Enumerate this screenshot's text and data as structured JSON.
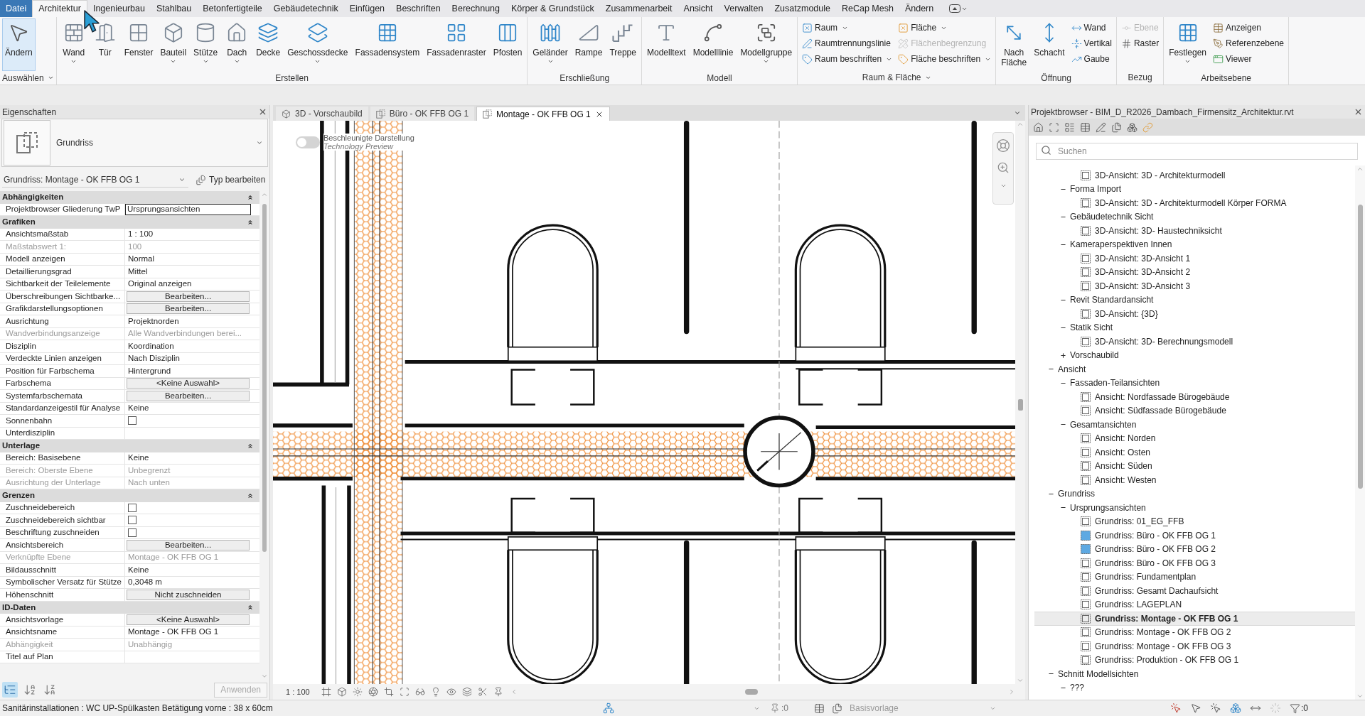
{
  "ribbon": {
    "tabs": [
      {
        "label": "Datei",
        "kind": "application",
        "selected": false
      },
      {
        "label": "Architektur",
        "kind": "tab",
        "selected": true
      },
      {
        "label": "Ingenieurbau",
        "kind": "tab",
        "selected": false
      },
      {
        "label": "Stahlbau",
        "kind": "tab",
        "selected": false
      },
      {
        "label": "Betonfertigteile",
        "kind": "tab",
        "selected": false
      },
      {
        "label": "Gebäudetechnik",
        "kind": "tab",
        "selected": false
      },
      {
        "label": "Einfügen",
        "kind": "tab",
        "selected": false
      },
      {
        "label": "Beschriften",
        "kind": "tab",
        "selected": false
      },
      {
        "label": "Berechnung",
        "kind": "tab",
        "selected": false
      },
      {
        "label": "Körper & Grundstück",
        "kind": "tab",
        "selected": false
      },
      {
        "label": "Zusammenarbeit",
        "kind": "tab",
        "selected": false
      },
      {
        "label": "Ansicht",
        "kind": "tab",
        "selected": false
      },
      {
        "label": "Verwalten",
        "kind": "tab",
        "selected": false
      },
      {
        "label": "Zusatzmodule",
        "kind": "tab",
        "selected": false
      },
      {
        "label": "ReCap Mesh",
        "kind": "tab",
        "selected": false
      },
      {
        "label": "Ändern",
        "kind": "tab",
        "selected": false
      }
    ],
    "panels": [
      {
        "title": "Auswählen",
        "menu": true,
        "tools": [
          {
            "label": "Ändern",
            "kind": "large",
            "menu": false,
            "active": true,
            "disabled": false
          }
        ]
      },
      {
        "title": "Erstellen",
        "menu": false,
        "tools": [
          {
            "label": "Wand",
            "kind": "large",
            "menu": true,
            "active": false,
            "disabled": false
          },
          {
            "label": "Tür",
            "kind": "large",
            "menu": false,
            "active": false,
            "disabled": false
          },
          {
            "label": "Fenster",
            "kind": "large",
            "menu": false,
            "active": false,
            "disabled": false
          },
          {
            "label": "Bauteil",
            "kind": "large",
            "menu": true,
            "active": false,
            "disabled": false
          },
          {
            "label": "Stütze",
            "kind": "large",
            "menu": true,
            "active": false,
            "disabled": false
          },
          {
            "label": "Dach",
            "kind": "large",
            "menu": true,
            "active": false,
            "disabled": false
          },
          {
            "label": "Decke",
            "kind": "large",
            "menu": false,
            "active": false,
            "disabled": false
          },
          {
            "label": "Geschossdecke",
            "kind": "large",
            "menu": true,
            "active": false,
            "disabled": false
          },
          {
            "label": "Fassadensystem",
            "kind": "large",
            "menu": false,
            "active": false,
            "disabled": false
          },
          {
            "label": "Fassadenraster",
            "kind": "large",
            "menu": false,
            "active": false,
            "disabled": false
          },
          {
            "label": "Pfosten",
            "kind": "large",
            "menu": false,
            "active": false,
            "disabled": false
          }
        ]
      },
      {
        "title": "Erschließung",
        "menu": false,
        "tools": [
          {
            "label": "Geländer",
            "kind": "large",
            "menu": true,
            "active": false,
            "disabled": false
          },
          {
            "label": "Rampe",
            "kind": "large",
            "menu": false,
            "active": false,
            "disabled": false
          },
          {
            "label": "Treppe",
            "kind": "large",
            "menu": false,
            "active": false,
            "disabled": false
          }
        ]
      },
      {
        "title": "Modell",
        "menu": false,
        "tools": [
          {
            "label": "Modelltext",
            "kind": "large",
            "menu": false,
            "active": false,
            "disabled": false
          },
          {
            "label": "Modelllinie",
            "kind": "large",
            "menu": false,
            "active": false,
            "disabled": false
          },
          {
            "label": "Modellgruppe",
            "kind": "large",
            "menu": true,
            "active": false,
            "disabled": false
          }
        ]
      },
      {
        "title": "Raum & Fläche",
        "menu": true,
        "tools": [
          {
            "label": "Raum",
            "kind": "small",
            "menu": true,
            "active": false,
            "disabled": false
          },
          {
            "label": "Raumtrennungslinie",
            "kind": "small",
            "menu": false,
            "active": false,
            "disabled": false
          },
          {
            "label": "Raum beschriften",
            "kind": "small",
            "menu": true,
            "active": false,
            "disabled": false
          },
          {
            "label": "Fläche",
            "kind": "small",
            "menu": true,
            "active": false,
            "disabled": false
          },
          {
            "label": "Flächenbegrenzung",
            "kind": "small",
            "menu": false,
            "active": false,
            "disabled": true
          },
          {
            "label": "Fläche beschriften",
            "kind": "small",
            "menu": true,
            "active": false,
            "disabled": false
          }
        ]
      },
      {
        "title": "Öffnung",
        "menu": false,
        "tools": [
          {
            "label": "Nach Fläche",
            "kind": "large",
            "menu": false,
            "active": false,
            "disabled": false
          },
          {
            "label": "Schacht",
            "kind": "large",
            "menu": false,
            "active": false,
            "disabled": false
          },
          {
            "label": "Wand",
            "kind": "small",
            "menu": false,
            "active": false,
            "disabled": false
          },
          {
            "label": "Vertikal",
            "kind": "small",
            "menu": false,
            "active": false,
            "disabled": false
          },
          {
            "label": "Gaube",
            "kind": "small",
            "menu": false,
            "active": false,
            "disabled": false
          }
        ]
      },
      {
        "title": "Bezug",
        "menu": false,
        "tools": [
          {
            "label": "Ebene",
            "kind": "small",
            "menu": false,
            "active": false,
            "disabled": true
          },
          {
            "label": "Raster",
            "kind": "small",
            "menu": false,
            "active": false,
            "disabled": false
          }
        ]
      },
      {
        "title": "Arbeitsebene",
        "menu": false,
        "tools": [
          {
            "label": "Festlegen",
            "kind": "large",
            "menu": true,
            "active": false,
            "disabled": false
          },
          {
            "label": "Anzeigen",
            "kind": "small",
            "menu": false,
            "active": false,
            "disabled": false
          },
          {
            "label": "Referenzebene",
            "kind": "small",
            "menu": false,
            "active": false,
            "disabled": false
          },
          {
            "label": "Viewer",
            "kind": "small",
            "menu": false,
            "active": false,
            "disabled": false
          }
        ]
      }
    ]
  },
  "properties": {
    "title": "Eigenschaften",
    "type_name": "Grundriss",
    "instance": "Grundriss: Montage - OK FFB OG 1",
    "edit_type": "Typ bearbeiten",
    "groups": [
      {
        "title": "Abhängigkeiten",
        "expanded": true,
        "rows": [
          {
            "label": "Projektbrowser Gliederung TwP",
            "value": "Ursprungsansichten",
            "kind": "input",
            "disabled": false
          }
        ]
      },
      {
        "title": "Grafiken",
        "expanded": true,
        "rows": [
          {
            "label": "Ansichtsmaßstab",
            "value": "1 : 100",
            "kind": "text",
            "disabled": false
          },
          {
            "label": "Maßstabswert 1:",
            "value": "100",
            "kind": "text",
            "disabled": true
          },
          {
            "label": "Modell anzeigen",
            "value": "Normal",
            "kind": "text",
            "disabled": false
          },
          {
            "label": "Detaillierungsgrad",
            "value": "Mittel",
            "kind": "text",
            "disabled": false
          },
          {
            "label": "Sichtbarkeit der Teilelemente",
            "value": "Original anzeigen",
            "kind": "text",
            "disabled": false
          },
          {
            "label": "Überschreibungen Sichtbarke...",
            "value": "Bearbeiten...",
            "kind": "button",
            "disabled": false
          },
          {
            "label": "Grafikdarstellungsoptionen",
            "value": "Bearbeiten...",
            "kind": "button",
            "disabled": false
          },
          {
            "label": "Ausrichtung",
            "value": "Projektnorden",
            "kind": "text",
            "disabled": false
          },
          {
            "label": "Wandverbindungsanzeige",
            "value": "Alle Wandverbindungen berei...",
            "kind": "text",
            "disabled": true
          },
          {
            "label": "Disziplin",
            "value": "Koordination",
            "kind": "text",
            "disabled": false
          },
          {
            "label": "Verdeckte Linien anzeigen",
            "value": "Nach Disziplin",
            "kind": "text",
            "disabled": false
          },
          {
            "label": "Position für Farbschema",
            "value": "Hintergrund",
            "kind": "text",
            "disabled": false
          },
          {
            "label": "Farbschema",
            "value": "<Keine Auswahl>",
            "kind": "button",
            "disabled": false
          },
          {
            "label": "Systemfarbschemata",
            "value": "Bearbeiten...",
            "kind": "button",
            "disabled": false
          },
          {
            "label": "Standardanzeigestil für Analyse",
            "value": "Keine",
            "kind": "text",
            "disabled": false
          },
          {
            "label": "Sonnenbahn",
            "kind": "checkbox",
            "checked": false,
            "disabled": false
          },
          {
            "label": "Unterdisziplin",
            "kind": "text",
            "disabled": false
          }
        ]
      },
      {
        "title": "Unterlage",
        "expanded": true,
        "rows": [
          {
            "label": "Bereich: Basisebene",
            "value": "Keine",
            "kind": "text",
            "disabled": false
          },
          {
            "label": "Bereich: Oberste Ebene",
            "value": "Unbegrenzt",
            "kind": "text",
            "disabled": true
          },
          {
            "label": "Ausrichtung der Unterlage",
            "value": "Nach unten",
            "kind": "text",
            "disabled": true
          }
        ]
      },
      {
        "title": "Grenzen",
        "expanded": true,
        "rows": [
          {
            "label": "Zuschneidebereich",
            "kind": "checkbox",
            "checked": false,
            "disabled": false
          },
          {
            "label": "Zuschneidebereich sichtbar",
            "kind": "checkbox",
            "checked": false,
            "disabled": false
          },
          {
            "label": "Beschriftung zuschneiden",
            "kind": "checkbox",
            "checked": false,
            "disabled": false
          },
          {
            "label": "Ansichtsbereich",
            "value": "Bearbeiten...",
            "kind": "button",
            "disabled": false
          },
          {
            "label": "Verknüpfte Ebene",
            "value": "Montage - OK FFB OG 1",
            "kind": "text",
            "disabled": true
          },
          {
            "label": "Bildausschnitt",
            "value": "Keine",
            "kind": "text",
            "disabled": false
          },
          {
            "label": "Symbolischer Versatz für Stütze",
            "value": "0,3048 m",
            "kind": "text",
            "disabled": false
          },
          {
            "label": "Höhenschnitt",
            "value": "Nicht zuschneiden",
            "kind": "button",
            "disabled": false
          }
        ]
      },
      {
        "title": "ID-Daten",
        "expanded": true,
        "rows": [
          {
            "label": "Ansichtsvorlage",
            "value": "<Keine Auswahl>",
            "kind": "button",
            "disabled": false
          },
          {
            "label": "Ansichtsname",
            "value": "Montage - OK FFB OG 1",
            "kind": "text",
            "disabled": false
          },
          {
            "label": "Abhängigkeit",
            "value": "Unabhängig",
            "kind": "text",
            "disabled": true
          },
          {
            "label": "Titel auf Plan",
            "kind": "text",
            "disabled": false
          }
        ]
      }
    ],
    "sort_modes": [
      {
        "selected": true
      },
      {
        "selected": false
      },
      {
        "selected": false
      }
    ],
    "apply": {
      "label": "Anwenden",
      "disabled": true
    }
  },
  "view_tabs": [
    {
      "label": "3D - Vorschaubild",
      "kind": "perspective",
      "selected": false
    },
    {
      "label": "Büro - OK FFB OG 1",
      "kind": "plan",
      "selected": false
    },
    {
      "label": "Montage - OK FFB OG 1",
      "kind": "plan",
      "selected": true
    }
  ],
  "canvas": {
    "toggle": {
      "label": "Beschleunigte Darstellung",
      "note": "Technology Preview",
      "on": false
    },
    "scale": "1 : 100"
  },
  "project_browser": {
    "title": "Projektbrowser - BIM_D_R2026_Dambach_Firmensitz_Architektur.rvt",
    "search": {
      "placeholder": "Suchen"
    },
    "tree": [
      {
        "kind": "group",
        "children": [
          {
            "kind": "group",
            "children": [
              {
                "kind": "view",
                "label": "3D-Ansicht: 3D - Architekturmodell",
                "selected": false,
                "filled_icon": false
              }
            ]
          },
          {
            "kind": "group",
            "label": "Forma Import",
            "expanded": true,
            "children": [
              {
                "kind": "view",
                "label": "3D-Ansicht: 3D - Architekturmodell Körper FORMA",
                "selected": false,
                "filled_icon": false
              }
            ]
          },
          {
            "kind": "group",
            "label": "Gebäudetechnik Sicht",
            "expanded": true,
            "children": [
              {
                "kind": "view",
                "label": "3D-Ansicht: 3D- Haustechniksicht",
                "selected": false,
                "filled_icon": false
              }
            ]
          },
          {
            "kind": "group",
            "label": "Kameraperspektiven Innen",
            "expanded": true,
            "children": [
              {
                "kind": "view",
                "label": "3D-Ansicht: 3D-Ansicht 1",
                "selected": false,
                "filled_icon": false
              },
              {
                "kind": "view",
                "label": "3D-Ansicht: 3D-Ansicht 2",
                "selected": false,
                "filled_icon": false
              },
              {
                "kind": "view",
                "label": "3D-Ansicht: 3D-Ansicht 3",
                "selected": false,
                "filled_icon": false
              }
            ]
          },
          {
            "kind": "group",
            "label": "Revit Standardansicht",
            "expanded": true,
            "children": [
              {
                "kind": "view",
                "label": "3D-Ansicht: {3D}",
                "selected": false,
                "filled_icon": false
              }
            ]
          },
          {
            "kind": "group",
            "label": "Statik Sicht",
            "expanded": true,
            "children": [
              {
                "kind": "view",
                "label": "3D-Ansicht: 3D- Berechnungsmodell",
                "selected": false,
                "filled_icon": false
              }
            ]
          },
          {
            "kind": "group",
            "label": "Vorschaubild",
            "expanded": false
          }
        ]
      },
      {
        "kind": "group",
        "label": "Ansicht",
        "expanded": true,
        "children": [
          {
            "kind": "group",
            "label": "Fassaden-Teilansichten",
            "expanded": true,
            "children": [
              {
                "kind": "view",
                "label": "Ansicht: Nordfassade Bürogebäude",
                "selected": false,
                "filled_icon": false
              },
              {
                "kind": "view",
                "label": "Ansicht: Südfassade Bürogebäude",
                "selected": false,
                "filled_icon": false
              }
            ]
          },
          {
            "kind": "group",
            "label": "Gesamtansichten",
            "expanded": true,
            "children": [
              {
                "kind": "view",
                "label": "Ansicht: Norden",
                "selected": false,
                "filled_icon": false
              },
              {
                "kind": "view",
                "label": "Ansicht: Osten",
                "selected": false,
                "filled_icon": false
              },
              {
                "kind": "view",
                "label": "Ansicht: Süden",
                "selected": false,
                "filled_icon": false
              },
              {
                "kind": "view",
                "label": "Ansicht: Westen",
                "selected": false,
                "filled_icon": false
              }
            ]
          }
        ]
      },
      {
        "kind": "group",
        "label": "Grundriss",
        "expanded": true,
        "children": [
          {
            "kind": "group",
            "label": "Ursprungsansichten",
            "expanded": true,
            "children": [
              {
                "kind": "view",
                "label": "Grundriss: 01_EG_FFB",
                "selected": false,
                "filled_icon": false
              },
              {
                "kind": "view",
                "label": "Grundriss: Büro - OK FFB OG 1",
                "selected": false,
                "filled_icon": true
              },
              {
                "kind": "view",
                "label": "Grundriss: Büro - OK FFB OG 2",
                "selected": false,
                "filled_icon": true
              },
              {
                "kind": "view",
                "label": "Grundriss: Büro - OK FFB OG 3",
                "selected": false,
                "filled_icon": false
              },
              {
                "kind": "view",
                "label": "Grundriss: Fundamentplan",
                "selected": false,
                "filled_icon": false
              },
              {
                "kind": "view",
                "label": "Grundriss: Gesamt Dachaufsicht",
                "selected": false,
                "filled_icon": false
              },
              {
                "kind": "view",
                "label": "Grundriss: LAGEPLAN",
                "selected": false,
                "filled_icon": false
              },
              {
                "kind": "view",
                "label": "Grundriss: Montage - OK FFB OG 1",
                "selected": true,
                "filled_icon": false
              },
              {
                "kind": "view",
                "label": "Grundriss: Montage - OK FFB OG 2",
                "selected": false,
                "filled_icon": false
              },
              {
                "kind": "view",
                "label": "Grundriss: Montage - OK FFB OG 3",
                "selected": false,
                "filled_icon": false
              },
              {
                "kind": "view",
                "label": "Grundriss: Produktion - OK FFB OG 1",
                "selected": false,
                "filled_icon": false
              }
            ]
          }
        ]
      },
      {
        "kind": "group",
        "label": "Schnitt Modellsichten",
        "expanded": true,
        "children": [
          {
            "kind": "group",
            "label": "???",
            "expanded": true
          }
        ]
      }
    ]
  },
  "status_bar": {
    "message": "Sanitärinstallationen : WC UP-Spülkasten Betätigung vorne : 38 x 60cm",
    "editable_count": ":0",
    "design_option": {
      "label": "Basisvorlage",
      "disabled": true
    },
    "filter_count": ":0"
  }
}
